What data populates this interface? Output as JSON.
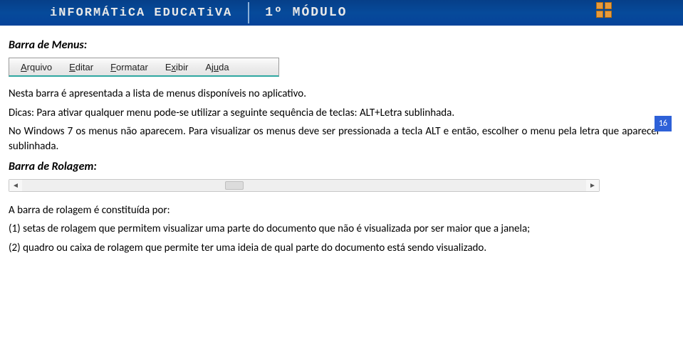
{
  "banner": {
    "title": "iNFORMÁTiCA EDUCATiVA",
    "module": "1º MÓDULO"
  },
  "page_number": "16",
  "section1_title": "Barra de Menus:",
  "menubar": {
    "items": [
      {
        "pre": "",
        "u": "A",
        "post": "rquivo"
      },
      {
        "pre": "",
        "u": "E",
        "post": "ditar"
      },
      {
        "pre": "",
        "u": "F",
        "post": "ormatar"
      },
      {
        "pre": "E",
        "u": "x",
        "post": "ibir"
      },
      {
        "pre": "Aj",
        "u": "u",
        "post": "da"
      }
    ]
  },
  "para1": "Nesta barra é apresentada a lista de menus disponíveis no aplicativo.",
  "para2": "Dicas: Para ativar qualquer menu pode-se utilizar a seguinte sequência de teclas: ALT+Letra sublinhada.",
  "para3": "No Windows 7 os menus não aparecem. Para visualizar os menus deve ser pressionada a tecla ALT e então, escolher o menu pela letra que aparecer sublinhada.",
  "section2_title": "Barra de Rolagem:",
  "para4": "A barra de rolagem é constituída por:",
  "list1": "(1) setas de rolagem que permitem visualizar uma parte do documento que não é visualizada por ser maior que a janela;",
  "list2": "(2) quadro ou caixa de rolagem que permite ter uma ideia de qual parte do documento está sendo visualizado."
}
